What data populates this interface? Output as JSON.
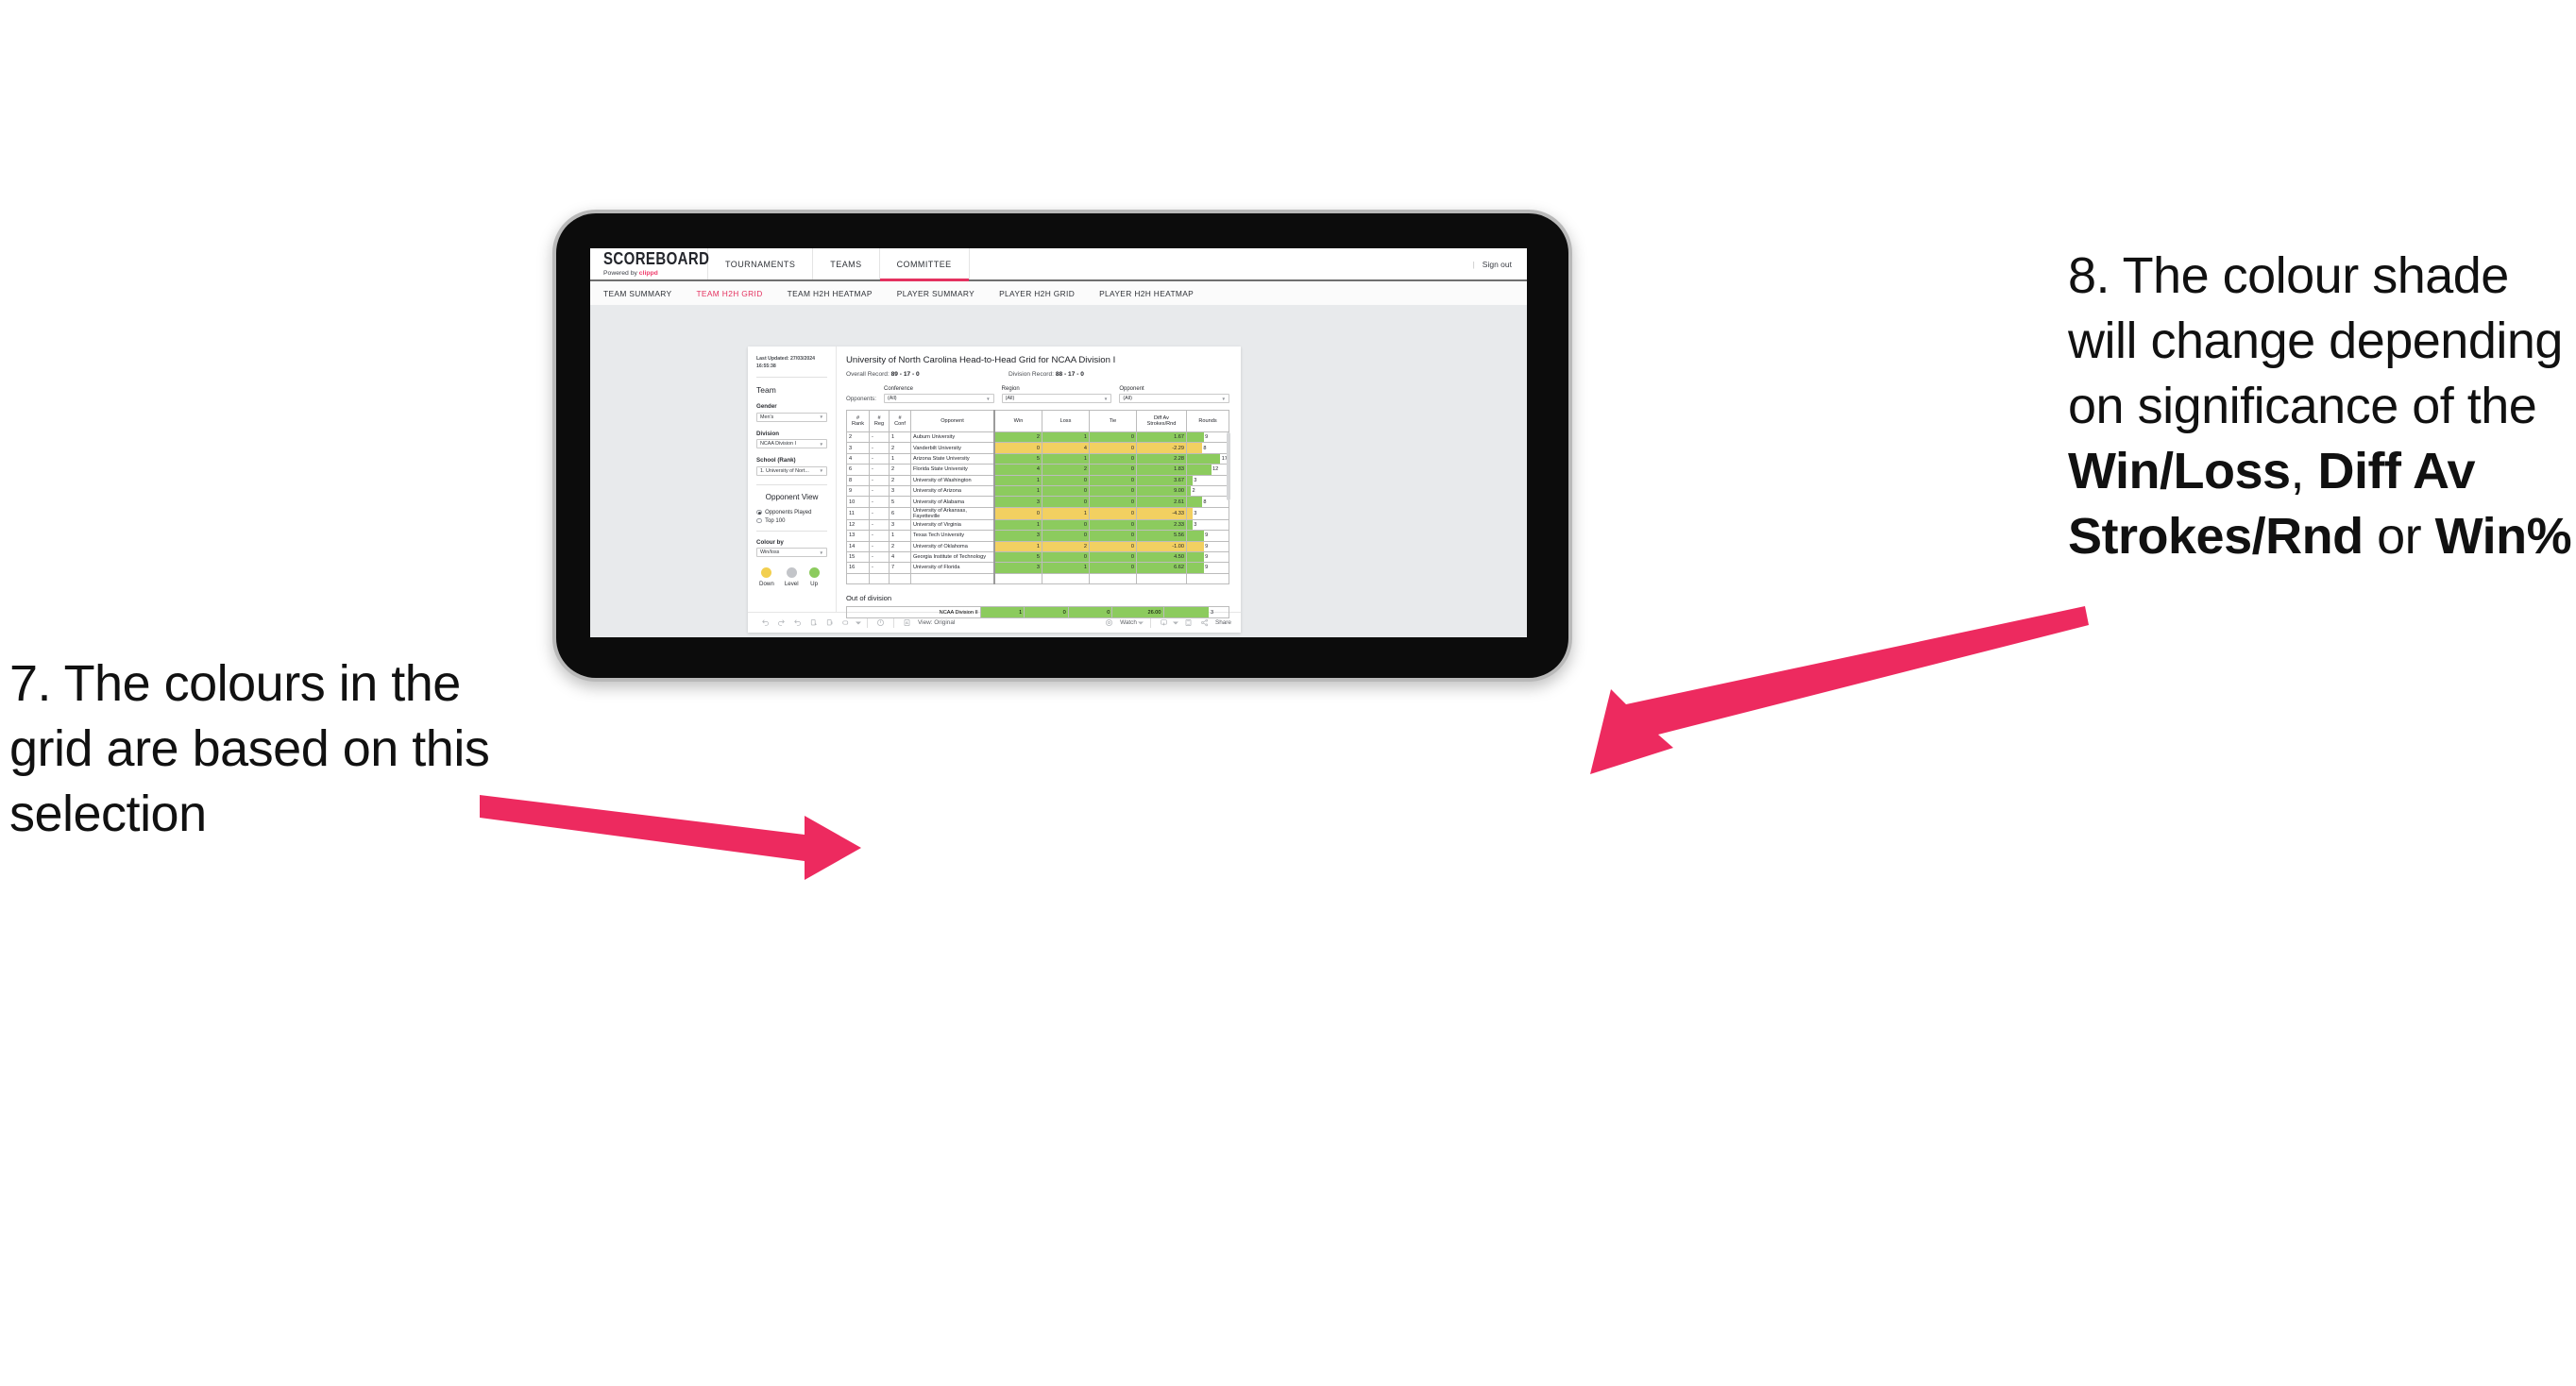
{
  "annotations": {
    "left": {
      "id": "7.",
      "text": "7. The colours in the grid are based on this selection"
    },
    "right": {
      "parts": [
        {
          "t": "8. The colour shade will change depending on significance of the ",
          "b": false
        },
        {
          "t": "Win/Loss",
          "b": true
        },
        {
          "t": ", ",
          "b": false
        },
        {
          "t": "Diff Av Strokes/Rnd",
          "b": true
        },
        {
          "t": " or ",
          "b": false
        },
        {
          "t": "Win%",
          "b": true
        }
      ]
    },
    "arrow_color": "#ed2a5f"
  },
  "app": {
    "brand": {
      "title": "SCOREBOARD",
      "powered_prefix": "Powered by ",
      "powered_name": "clippd"
    },
    "topnav": [
      {
        "label": "TOURNAMENTS",
        "active": false
      },
      {
        "label": "TEAMS",
        "active": false
      },
      {
        "label": "COMMITTEE",
        "active": true
      }
    ],
    "signout": "Sign out",
    "separator": "|",
    "subnav": [
      {
        "label": "TEAM SUMMARY",
        "active": false
      },
      {
        "label": "TEAM H2H GRID",
        "active": true
      },
      {
        "label": "TEAM H2H HEATMAP",
        "active": false
      },
      {
        "label": "PLAYER SUMMARY",
        "active": false
      },
      {
        "label": "PLAYER H2H GRID",
        "active": false
      },
      {
        "label": "PLAYER H2H HEATMAP",
        "active": false
      }
    ],
    "accent": "#e4315f"
  },
  "sidebar": {
    "last_updated": "Last Updated: 27/03/2024 16:55:38",
    "team_heading": "Team",
    "gender": {
      "label": "Gender",
      "value": "Men's"
    },
    "division": {
      "label": "Division",
      "value": "NCAA Division I"
    },
    "school": {
      "label": "School (Rank)",
      "value": "1. University of Nort..."
    },
    "opponent_view": {
      "heading": "Opponent View",
      "options": [
        {
          "label": "Opponents Played",
          "selected": true
        },
        {
          "label": "Top 100",
          "selected": false
        }
      ]
    },
    "colour_by": {
      "label": "Colour by",
      "value": "Win/loss"
    },
    "legend": [
      {
        "label": "Down",
        "color": "#f2cf4f"
      },
      {
        "label": "Level",
        "color": "#c3c5c9"
      },
      {
        "label": "Up",
        "color": "#8ccb5e"
      }
    ]
  },
  "main": {
    "title": "University of North Carolina Head-to-Head Grid for NCAA Division I",
    "overall_record_label": "Overall Record: ",
    "overall_record_value": "89 - 17 - 0",
    "division_record_label": "Division Record: ",
    "division_record_value": "88 - 17 - 0",
    "opponents_label": "Opponents:",
    "filters": [
      {
        "label": "Conference",
        "value": "(All)"
      },
      {
        "label": "Region",
        "value": "(All)"
      },
      {
        "label": "Opponent",
        "value": "(All)"
      }
    ],
    "columns": [
      {
        "l1": "#",
        "l2": "Rank"
      },
      {
        "l1": "#",
        "l2": "Reg"
      },
      {
        "l1": "#",
        "l2": "Conf"
      },
      {
        "l1": "",
        "l2": "Opponent"
      },
      {
        "l1": "",
        "l2": "Win"
      },
      {
        "l1": "",
        "l2": "Loss"
      },
      {
        "l1": "",
        "l2": "Tie"
      },
      {
        "l1": "Diff Av",
        "l2": "Strokes/Rnd"
      },
      {
        "l1": "",
        "l2": "Rounds"
      }
    ],
    "rows": [
      {
        "rank": "2",
        "reg": "-",
        "conf": "1",
        "opponent": "Auburn University",
        "win": "2",
        "loss": "1",
        "tie": "0",
        "diff": "1.67",
        "rounds": "9",
        "rounds_pct": 40,
        "color": "#8ccb5e"
      },
      {
        "rank": "3",
        "reg": "-",
        "conf": "2",
        "opponent": "Vanderbilt University",
        "win": "0",
        "loss": "4",
        "tie": "0",
        "diff": "-2.29",
        "rounds": "8",
        "rounds_pct": 36,
        "color": "#f2d061"
      },
      {
        "rank": "4",
        "reg": "-",
        "conf": "1",
        "opponent": "Arizona State University",
        "win": "5",
        "loss": "1",
        "tie": "0",
        "diff": "2.28",
        "rounds": "17",
        "rounds_pct": 80,
        "color": "#8ccb5e"
      },
      {
        "rank": "6",
        "reg": "-",
        "conf": "2",
        "opponent": "Florida State University",
        "win": "4",
        "loss": "2",
        "tie": "0",
        "diff": "1.83",
        "rounds": "12",
        "rounds_pct": 58,
        "color": "#8ccb5e"
      },
      {
        "rank": "8",
        "reg": "-",
        "conf": "2",
        "opponent": "University of Washington",
        "win": "1",
        "loss": "0",
        "tie": "0",
        "diff": "3.67",
        "rounds": "3",
        "rounds_pct": 13,
        "color": "#8ccb5e"
      },
      {
        "rank": "9",
        "reg": "-",
        "conf": "3",
        "opponent": "University of Arizona",
        "win": "1",
        "loss": "0",
        "tie": "0",
        "diff": "9.00",
        "rounds": "2",
        "rounds_pct": 9,
        "color": "#8ccb5e"
      },
      {
        "rank": "10",
        "reg": "-",
        "conf": "5",
        "opponent": "University of Alabama",
        "win": "3",
        "loss": "0",
        "tie": "0",
        "diff": "2.61",
        "rounds": "8",
        "rounds_pct": 36,
        "color": "#8ccb5e"
      },
      {
        "rank": "11",
        "reg": "-",
        "conf": "6",
        "opponent": "University of Arkansas, Fayetteville",
        "win": "0",
        "loss": "1",
        "tie": "0",
        "diff": "-4.33",
        "rounds": "3",
        "rounds_pct": 13,
        "color": "#f2d061"
      },
      {
        "rank": "12",
        "reg": "-",
        "conf": "3",
        "opponent": "University of Virginia",
        "win": "1",
        "loss": "0",
        "tie": "0",
        "diff": "2.33",
        "rounds": "3",
        "rounds_pct": 13,
        "color": "#8ccb5e"
      },
      {
        "rank": "13",
        "reg": "-",
        "conf": "1",
        "opponent": "Texas Tech University",
        "win": "3",
        "loss": "0",
        "tie": "0",
        "diff": "5.56",
        "rounds": "9",
        "rounds_pct": 40,
        "color": "#8ccb5e"
      },
      {
        "rank": "14",
        "reg": "-",
        "conf": "2",
        "opponent": "University of Oklahoma",
        "win": "1",
        "loss": "2",
        "tie": "0",
        "diff": "-1.00",
        "rounds": "9",
        "rounds_pct": 40,
        "color": "#f2d061"
      },
      {
        "rank": "15",
        "reg": "-",
        "conf": "4",
        "opponent": "Georgia Institute of Technology",
        "win": "5",
        "loss": "0",
        "tie": "0",
        "diff": "4.50",
        "rounds": "9",
        "rounds_pct": 40,
        "color": "#8ccb5e"
      },
      {
        "rank": "16",
        "reg": "-",
        "conf": "7",
        "opponent": "University of Florida",
        "win": "3",
        "loss": "1",
        "tie": "0",
        "diff": "6.62",
        "rounds": "9",
        "rounds_pct": 40,
        "color": "#8ccb5e"
      }
    ],
    "out_of_division": {
      "heading": "Out of division",
      "row": {
        "opponent": "NCAA Division II",
        "win": "1",
        "loss": "0",
        "tie": "0",
        "diff": "26.00",
        "rounds": "3",
        "rounds_pct": 70,
        "color": "#8ccb5e"
      }
    }
  },
  "toolbar": {
    "undo": "undo-icon",
    "redo": "redo-icon",
    "revert": "revert-icon",
    "refresh": "refresh-icon",
    "pause": "pause-icon",
    "export": "export-icon",
    "help": "help-icon",
    "view_label": "View: Original",
    "watch_label": "Watch",
    "share_label": "Share"
  },
  "chart_data": {
    "type": "table",
    "title": "University of North Carolina Head-to-Head Grid for NCAA Division I",
    "columns": [
      "# Rank",
      "# Reg",
      "# Conf",
      "Opponent",
      "Win",
      "Loss",
      "Tie",
      "Diff Av Strokes/Rnd",
      "Rounds"
    ],
    "rows": [
      [
        "2",
        "-",
        "1",
        "Auburn University",
        2,
        1,
        0,
        1.67,
        9
      ],
      [
        "3",
        "-",
        "2",
        "Vanderbilt University",
        0,
        4,
        0,
        -2.29,
        8
      ],
      [
        "4",
        "-",
        "1",
        "Arizona State University",
        5,
        1,
        0,
        2.28,
        17
      ],
      [
        "6",
        "-",
        "2",
        "Florida State University",
        4,
        2,
        0,
        1.83,
        12
      ],
      [
        "8",
        "-",
        "2",
        "University of Washington",
        1,
        0,
        0,
        3.67,
        3
      ],
      [
        "9",
        "-",
        "3",
        "University of Arizona",
        1,
        0,
        0,
        9.0,
        2
      ],
      [
        "10",
        "-",
        "5",
        "University of Alabama",
        3,
        0,
        0,
        2.61,
        8
      ],
      [
        "11",
        "-",
        "6",
        "University of Arkansas, Fayetteville",
        0,
        1,
        0,
        -4.33,
        3
      ],
      [
        "12",
        "-",
        "3",
        "University of Virginia",
        1,
        0,
        0,
        2.33,
        3
      ],
      [
        "13",
        "-",
        "1",
        "Texas Tech University",
        3,
        0,
        0,
        5.56,
        9
      ],
      [
        "14",
        "-",
        "2",
        "University of Oklahoma",
        1,
        2,
        0,
        -1.0,
        9
      ],
      [
        "15",
        "-",
        "4",
        "Georgia Institute of Technology",
        5,
        0,
        0,
        4.5,
        9
      ],
      [
        "16",
        "-",
        "7",
        "University of Florida",
        3,
        1,
        0,
        6.62,
        9
      ]
    ],
    "out_of_division": [
      [
        "NCAA Division II",
        1,
        0,
        0,
        26.0,
        3
      ]
    ],
    "colour_encoding": {
      "up": "#8ccb5e",
      "down": "#f2d061",
      "level": "#c3c5c9",
      "colour_by": "Win/loss"
    }
  }
}
